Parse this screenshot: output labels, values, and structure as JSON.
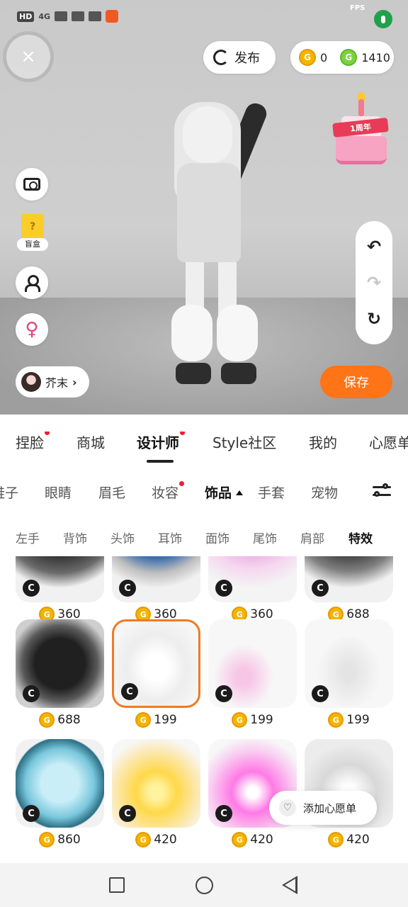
{
  "status_bar": {
    "hd": "HD",
    "network": "4G",
    "fps": "FPS",
    "icons": [
      "signal-icon",
      "wifi-icon",
      "video-icon",
      "app-notification-icon",
      "mic-icon"
    ]
  },
  "top_bar": {
    "publish_label": "发布",
    "coin_gold_count": "0",
    "coin_green_count": "1410",
    "coin_symbol": "G"
  },
  "anniversary_badge": "1周年",
  "side_tools": {
    "blind_box_label": "盲盒",
    "blind_box_mark": "?",
    "icons": [
      "camera-icon",
      "blind-box-icon",
      "profile-id-icon",
      "gender-switch-icon"
    ]
  },
  "user": {
    "name": "芥末"
  },
  "history": {
    "undo": "↶",
    "redo": "↷",
    "reset": "↻"
  },
  "save_label": "保存",
  "main_tabs": [
    {
      "label": "捏脸",
      "dot": true
    },
    {
      "label": "商城",
      "dot": false
    },
    {
      "label": "设计师",
      "dot": true,
      "active": true
    },
    {
      "label": "Style社区",
      "dot": false
    },
    {
      "label": "我的",
      "dot": false
    },
    {
      "label": "心愿单",
      "dot": false
    }
  ],
  "sub_tabs": [
    {
      "label": "鞋子"
    },
    {
      "label": "眼睛"
    },
    {
      "label": "眉毛"
    },
    {
      "label": "妆容",
      "dot": true
    },
    {
      "label": "饰品",
      "active": true
    },
    {
      "label": "手套"
    },
    {
      "label": "宠物"
    }
  ],
  "categories": [
    {
      "label": "左手"
    },
    {
      "label": "背饰"
    },
    {
      "label": "头饰"
    },
    {
      "label": "耳饰"
    },
    {
      "label": "面饰"
    },
    {
      "label": "尾饰"
    },
    {
      "label": "肩部"
    },
    {
      "label": "特效",
      "active": true
    }
  ],
  "items": [
    {
      "price": "360",
      "theme": "dark-hex",
      "badge": "C"
    },
    {
      "price": "360",
      "theme": "teal-star",
      "badge": "C"
    },
    {
      "price": "360",
      "theme": "pink-star",
      "badge": "C"
    },
    {
      "price": "688",
      "theme": "dark-circle",
      "badge": "C"
    },
    {
      "price": "688",
      "theme": "dark-hex-full",
      "badge": "C"
    },
    {
      "price": "199",
      "theme": "silver-ring",
      "badge": "C",
      "selected": true
    },
    {
      "price": "199",
      "theme": "pink-ring",
      "badge": "C"
    },
    {
      "price": "199",
      "theme": "silver-ring-2",
      "badge": "C"
    },
    {
      "price": "860",
      "theme": "blue-bubble",
      "badge": "C"
    },
    {
      "price": "420",
      "theme": "gold-star",
      "badge": "C"
    },
    {
      "price": "420",
      "theme": "magenta-star",
      "badge": "C"
    },
    {
      "price": "420",
      "theme": "white-star",
      "badge": "C"
    }
  ],
  "wishlist_button": {
    "label": "添加心愿单",
    "icon": "♡"
  },
  "colors": {
    "accent_orange": "#ff7417",
    "red_dot": "#ee1d36",
    "coin_gold": "#f5b400",
    "coin_green": "#7bd43e"
  },
  "system_nav": [
    "recents-icon",
    "home-icon",
    "back-icon"
  ]
}
